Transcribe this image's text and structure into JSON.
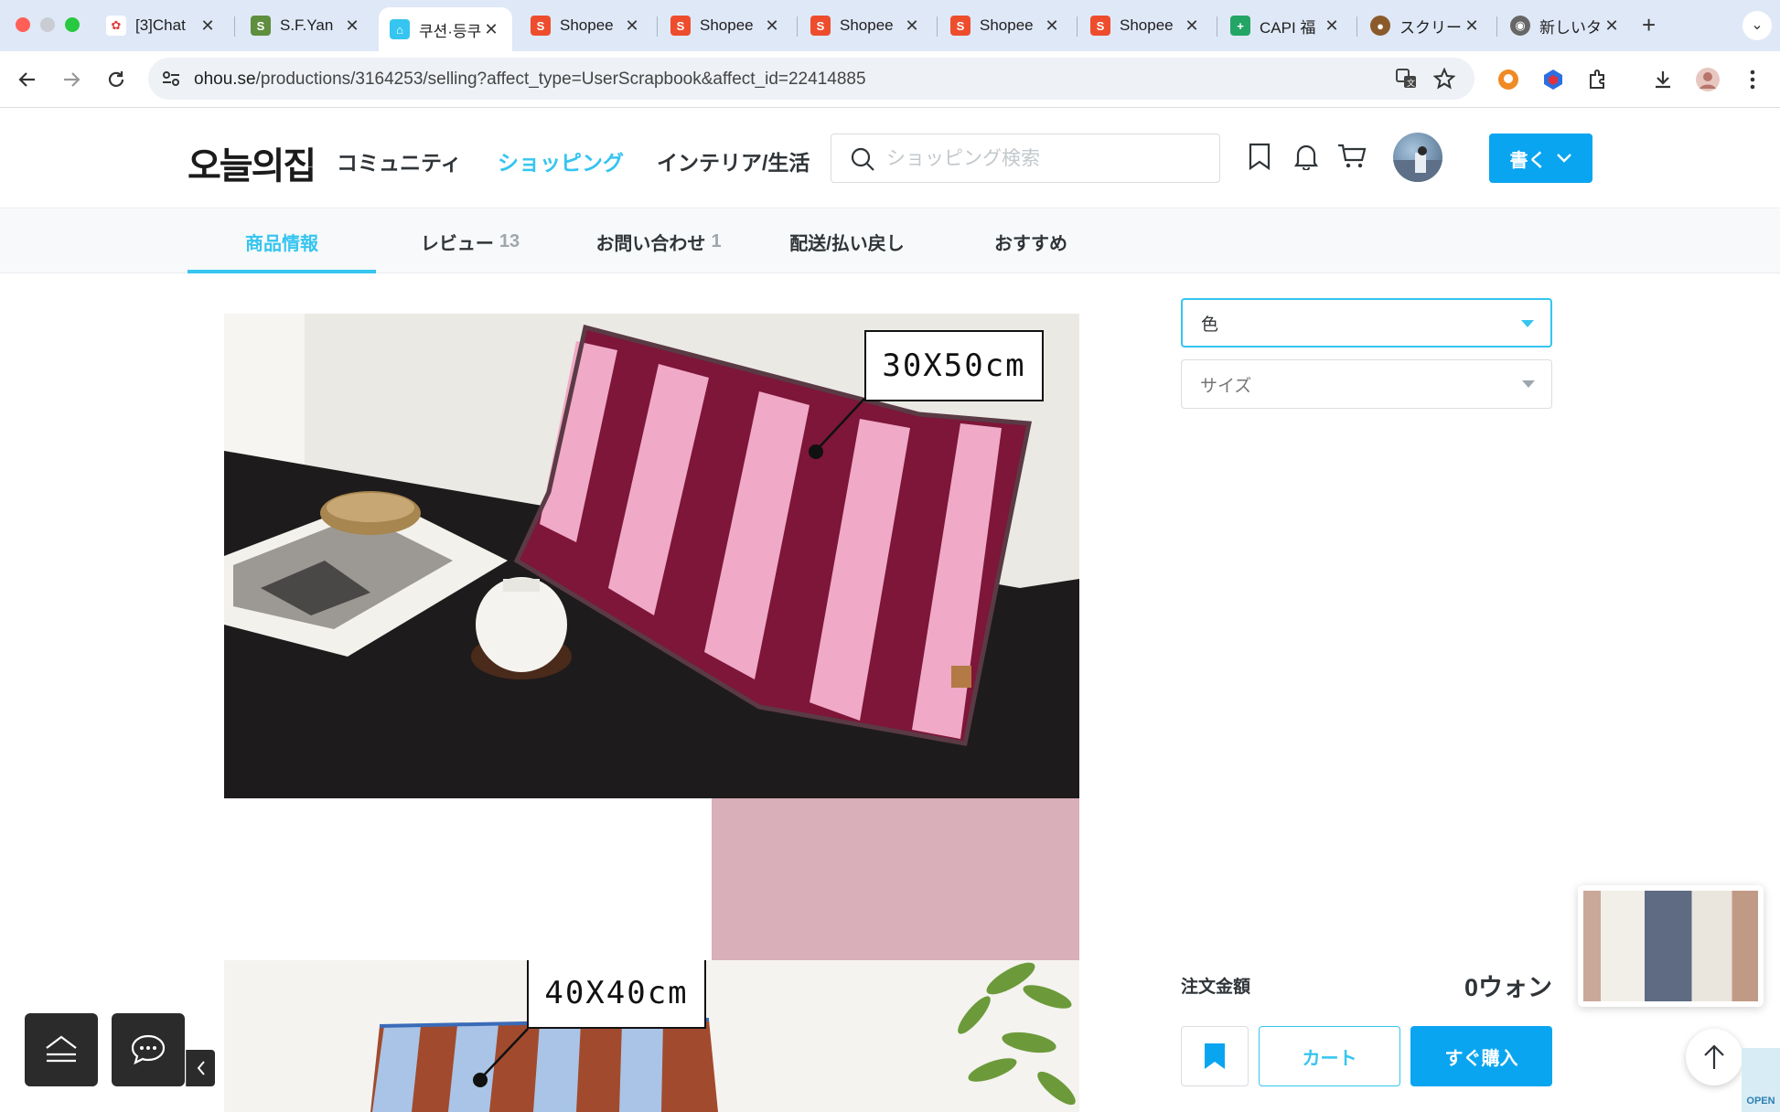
{
  "browser": {
    "tabs": [
      {
        "title": "[3]Chat",
        "favicon": "chat-icon"
      },
      {
        "title": "S.F.Yan",
        "favicon": "shopify-icon"
      },
      {
        "title": "쿠션·등쿠",
        "favicon": "ohou-icon",
        "active": true
      },
      {
        "title": "Shopee",
        "favicon": "shopee-icon"
      },
      {
        "title": "Shopee",
        "favicon": "shopee-icon"
      },
      {
        "title": "Shopee",
        "favicon": "shopee-icon"
      },
      {
        "title": "Shopee",
        "favicon": "shopee-icon"
      },
      {
        "title": "Shopee",
        "favicon": "shopee-icon"
      },
      {
        "title": "CAPI 福",
        "favicon": "sheets-icon"
      },
      {
        "title": "スクリー",
        "favicon": "screenshot-icon"
      },
      {
        "title": "新しいタ",
        "favicon": "chrome-icon"
      }
    ],
    "url_host": "ohou.se",
    "url_path": "/productions/3164253/selling?affect_type=UserScrapbook&affect_id=22414885"
  },
  "header": {
    "logo": "오늘의집",
    "nav": [
      "コミュニティ",
      "ショッピング",
      "インテリア/生活"
    ],
    "active_nav": "ショッピング",
    "search_placeholder": "ショッピング検索",
    "write_label": "書く"
  },
  "subnav": {
    "tabs": [
      {
        "label": "商品情報",
        "count": ""
      },
      {
        "label": "レビュー",
        "count": "13"
      },
      {
        "label": "お問い合わせ",
        "count": "1"
      },
      {
        "label": "配送/払い戻し",
        "count": ""
      },
      {
        "label": "おすすめ",
        "count": ""
      }
    ]
  },
  "content": {
    "label_1": "30X50cm",
    "label_2": "40X40cm"
  },
  "options": {
    "color_label": "色",
    "size_label": "サイズ"
  },
  "order": {
    "total_label": "注文金額",
    "total_value": "0ウォン",
    "cart_label": "カート",
    "buy_label": "すぐ購入"
  },
  "floating": {
    "open_badge": "OPEN"
  },
  "colors": {
    "accent": "#35c5f0",
    "button": "#0aa5f0",
    "stripe_dark": "#7d1638",
    "stripe_light": "#f0a9c6",
    "stripe_rust": "#a24a2e",
    "stripe_blue": "#a9c4e6"
  }
}
